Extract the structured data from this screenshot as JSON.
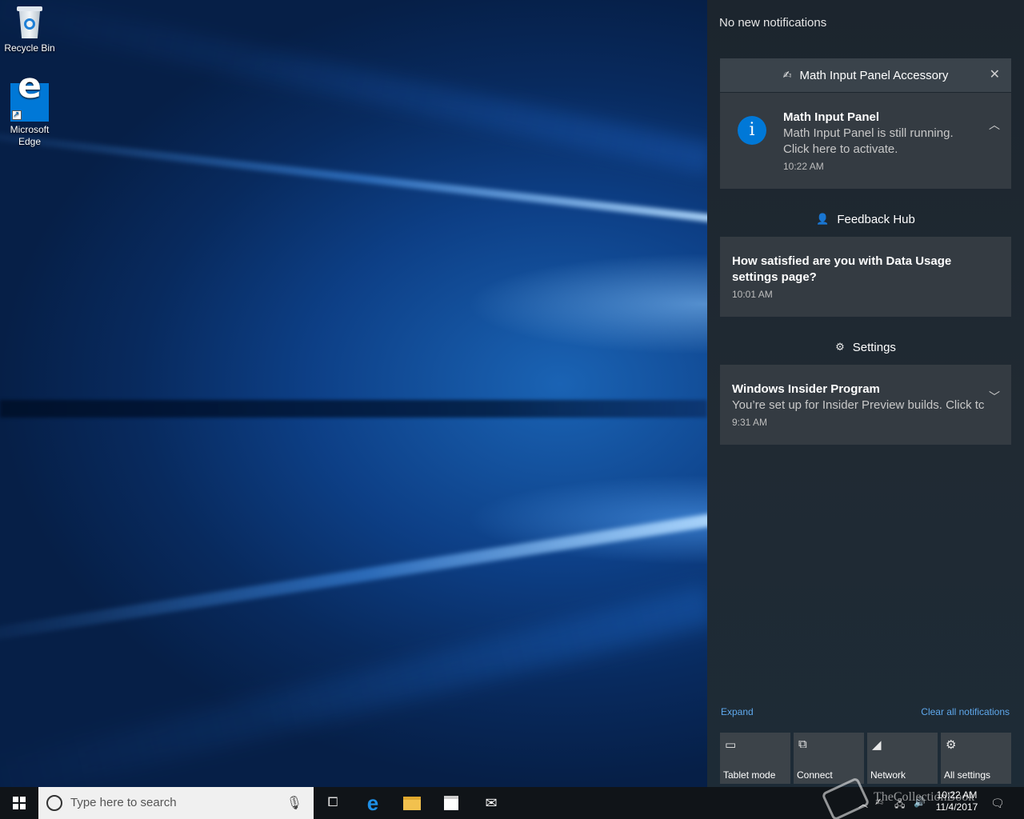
{
  "desktop": {
    "icons": [
      {
        "label": "Recycle Bin"
      },
      {
        "label": "Microsoft\nEdge",
        "line1": "Microsoft",
        "line2": "Edge"
      }
    ]
  },
  "action_center": {
    "header": "No new notifications",
    "groups": [
      {
        "app": "Math Input Panel Accessory",
        "close": "✕",
        "notification": {
          "title": "Math Input Panel",
          "body_line1": "Math Input Panel is still running.",
          "body_line2": "Click here to activate.",
          "time": "10:22 AM",
          "icon": "i"
        }
      },
      {
        "app": "Feedback Hub",
        "notification": {
          "title_line1": "How satisfied are you with Data Usage",
          "title_line2": "settings page?",
          "time": "10:01 AM"
        }
      },
      {
        "app": "Settings",
        "notification": {
          "title": "Windows Insider Program",
          "body": "You’re set up for Insider Preview builds. Click tc",
          "time": "9:31 AM"
        }
      }
    ],
    "expand": "Expand",
    "clear_all": "Clear all notifications",
    "quick_actions": [
      {
        "label": "Tablet mode",
        "icon": "tablet-mode-icon"
      },
      {
        "label": "Connect",
        "icon": "connect-icon"
      },
      {
        "label": "Network",
        "icon": "network-icon"
      },
      {
        "label": "All settings",
        "icon": "gear-icon"
      }
    ]
  },
  "taskbar": {
    "search_placeholder": "Type here to search",
    "clock_time": "10:22 AM",
    "clock_date": "11/4/2017"
  },
  "watermark": "TheCollectionBook",
  "colors": {
    "accent": "#0078d7",
    "link": "#5fa8ec",
    "panel": "#1f2830",
    "toast": "#343b42"
  }
}
